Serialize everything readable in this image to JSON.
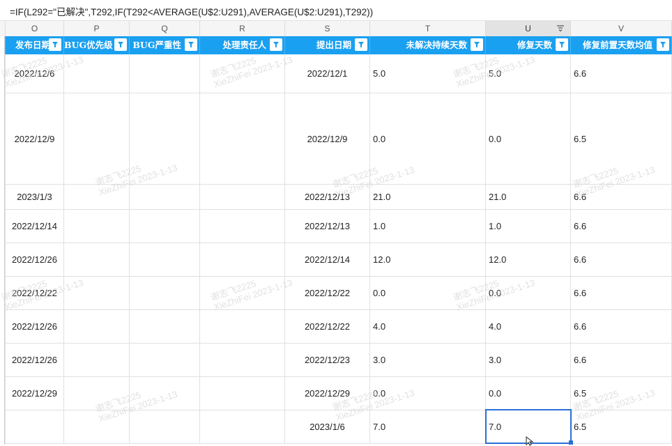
{
  "formula": "=IF(L292=\"已解决\",T292,IF(T292<AVERAGE(U$2:U291),AVERAGE(U$2:U291),T292))",
  "columns": {
    "letters": [
      "O",
      "P",
      "Q",
      "R",
      "S",
      "T",
      "U",
      "V"
    ],
    "headers": [
      "发布日期",
      "BUG优先级",
      "BUG严重性",
      "处理责任人",
      "提出日期",
      "未解决持续天数",
      "修复天数",
      "修复前置天数均值"
    ]
  },
  "rows": [
    {
      "O": "2022/12/6",
      "P": "",
      "Q": "",
      "R": "",
      "S": "2022/12/1",
      "T": "5.0",
      "U": "5.0",
      "V": "6.6"
    },
    {
      "O": "2022/12/9",
      "P": "",
      "Q": "",
      "R": "",
      "S": "2022/12/9",
      "T": "0.0",
      "U": "0.0",
      "V": "6.5"
    },
    {
      "O": "2023/1/3",
      "P": "",
      "Q": "",
      "R": "",
      "S": "2022/12/13",
      "T": "21.0",
      "U": "21.0",
      "V": "6.6"
    },
    {
      "O": "2022/12/14",
      "P": "",
      "Q": "",
      "R": "",
      "S": "2022/12/13",
      "T": "1.0",
      "U": "1.0",
      "V": "6.6"
    },
    {
      "O": "2022/12/26",
      "P": "",
      "Q": "",
      "R": "",
      "S": "2022/12/14",
      "T": "12.0",
      "U": "12.0",
      "V": "6.6"
    },
    {
      "O": "2022/12/22",
      "P": "",
      "Q": "",
      "R": "",
      "S": "2022/12/22",
      "T": "0.0",
      "U": "0.0",
      "V": "6.6"
    },
    {
      "O": "2022/12/26",
      "P": "",
      "Q": "",
      "R": "",
      "S": "2022/12/22",
      "T": "4.0",
      "U": "4.0",
      "V": "6.6"
    },
    {
      "O": "2022/12/26",
      "P": "",
      "Q": "",
      "R": "",
      "S": "2022/12/23",
      "T": "3.0",
      "U": "3.0",
      "V": "6.6"
    },
    {
      "O": "2022/12/29",
      "P": "",
      "Q": "",
      "R": "",
      "S": "2022/12/29",
      "T": "0.0",
      "U": "0.0",
      "V": "6.5"
    },
    {
      "O": "",
      "P": "",
      "Q": "",
      "R": "",
      "S": "2023/1/6",
      "T": "7.0",
      "U": "7.0",
      "V": "6.5"
    }
  ],
  "watermark": {
    "line1": "谢志飞2225",
    "line2": "XieZhiFei 2023-1-13"
  },
  "colors": {
    "header_bg": "#1aa0f0",
    "selection": "#2a6fd6"
  }
}
